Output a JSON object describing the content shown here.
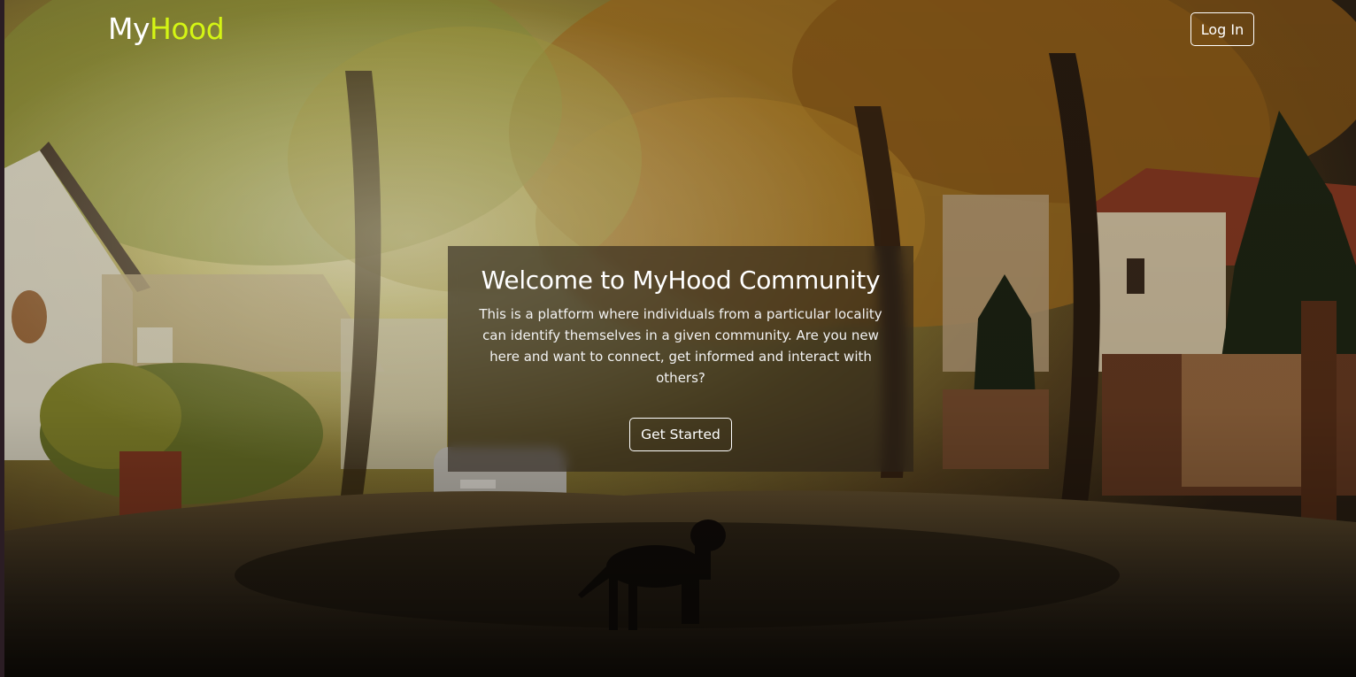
{
  "nav": {
    "logo_part1": "My",
    "logo_part2": "Hood",
    "login_label": "Log In"
  },
  "hero": {
    "title": "Welcome to MyHood Community",
    "description": "This is a platform where individuals from a particular locality can identify themselves in a given community. Are you new here and want to connect, get informed and interact with others?",
    "cta_label": "Get Started"
  },
  "colors": {
    "logo_accent": "#d4f514",
    "text": "#ffffff",
    "card_background": "rgba(40,32,24,0.62)"
  }
}
